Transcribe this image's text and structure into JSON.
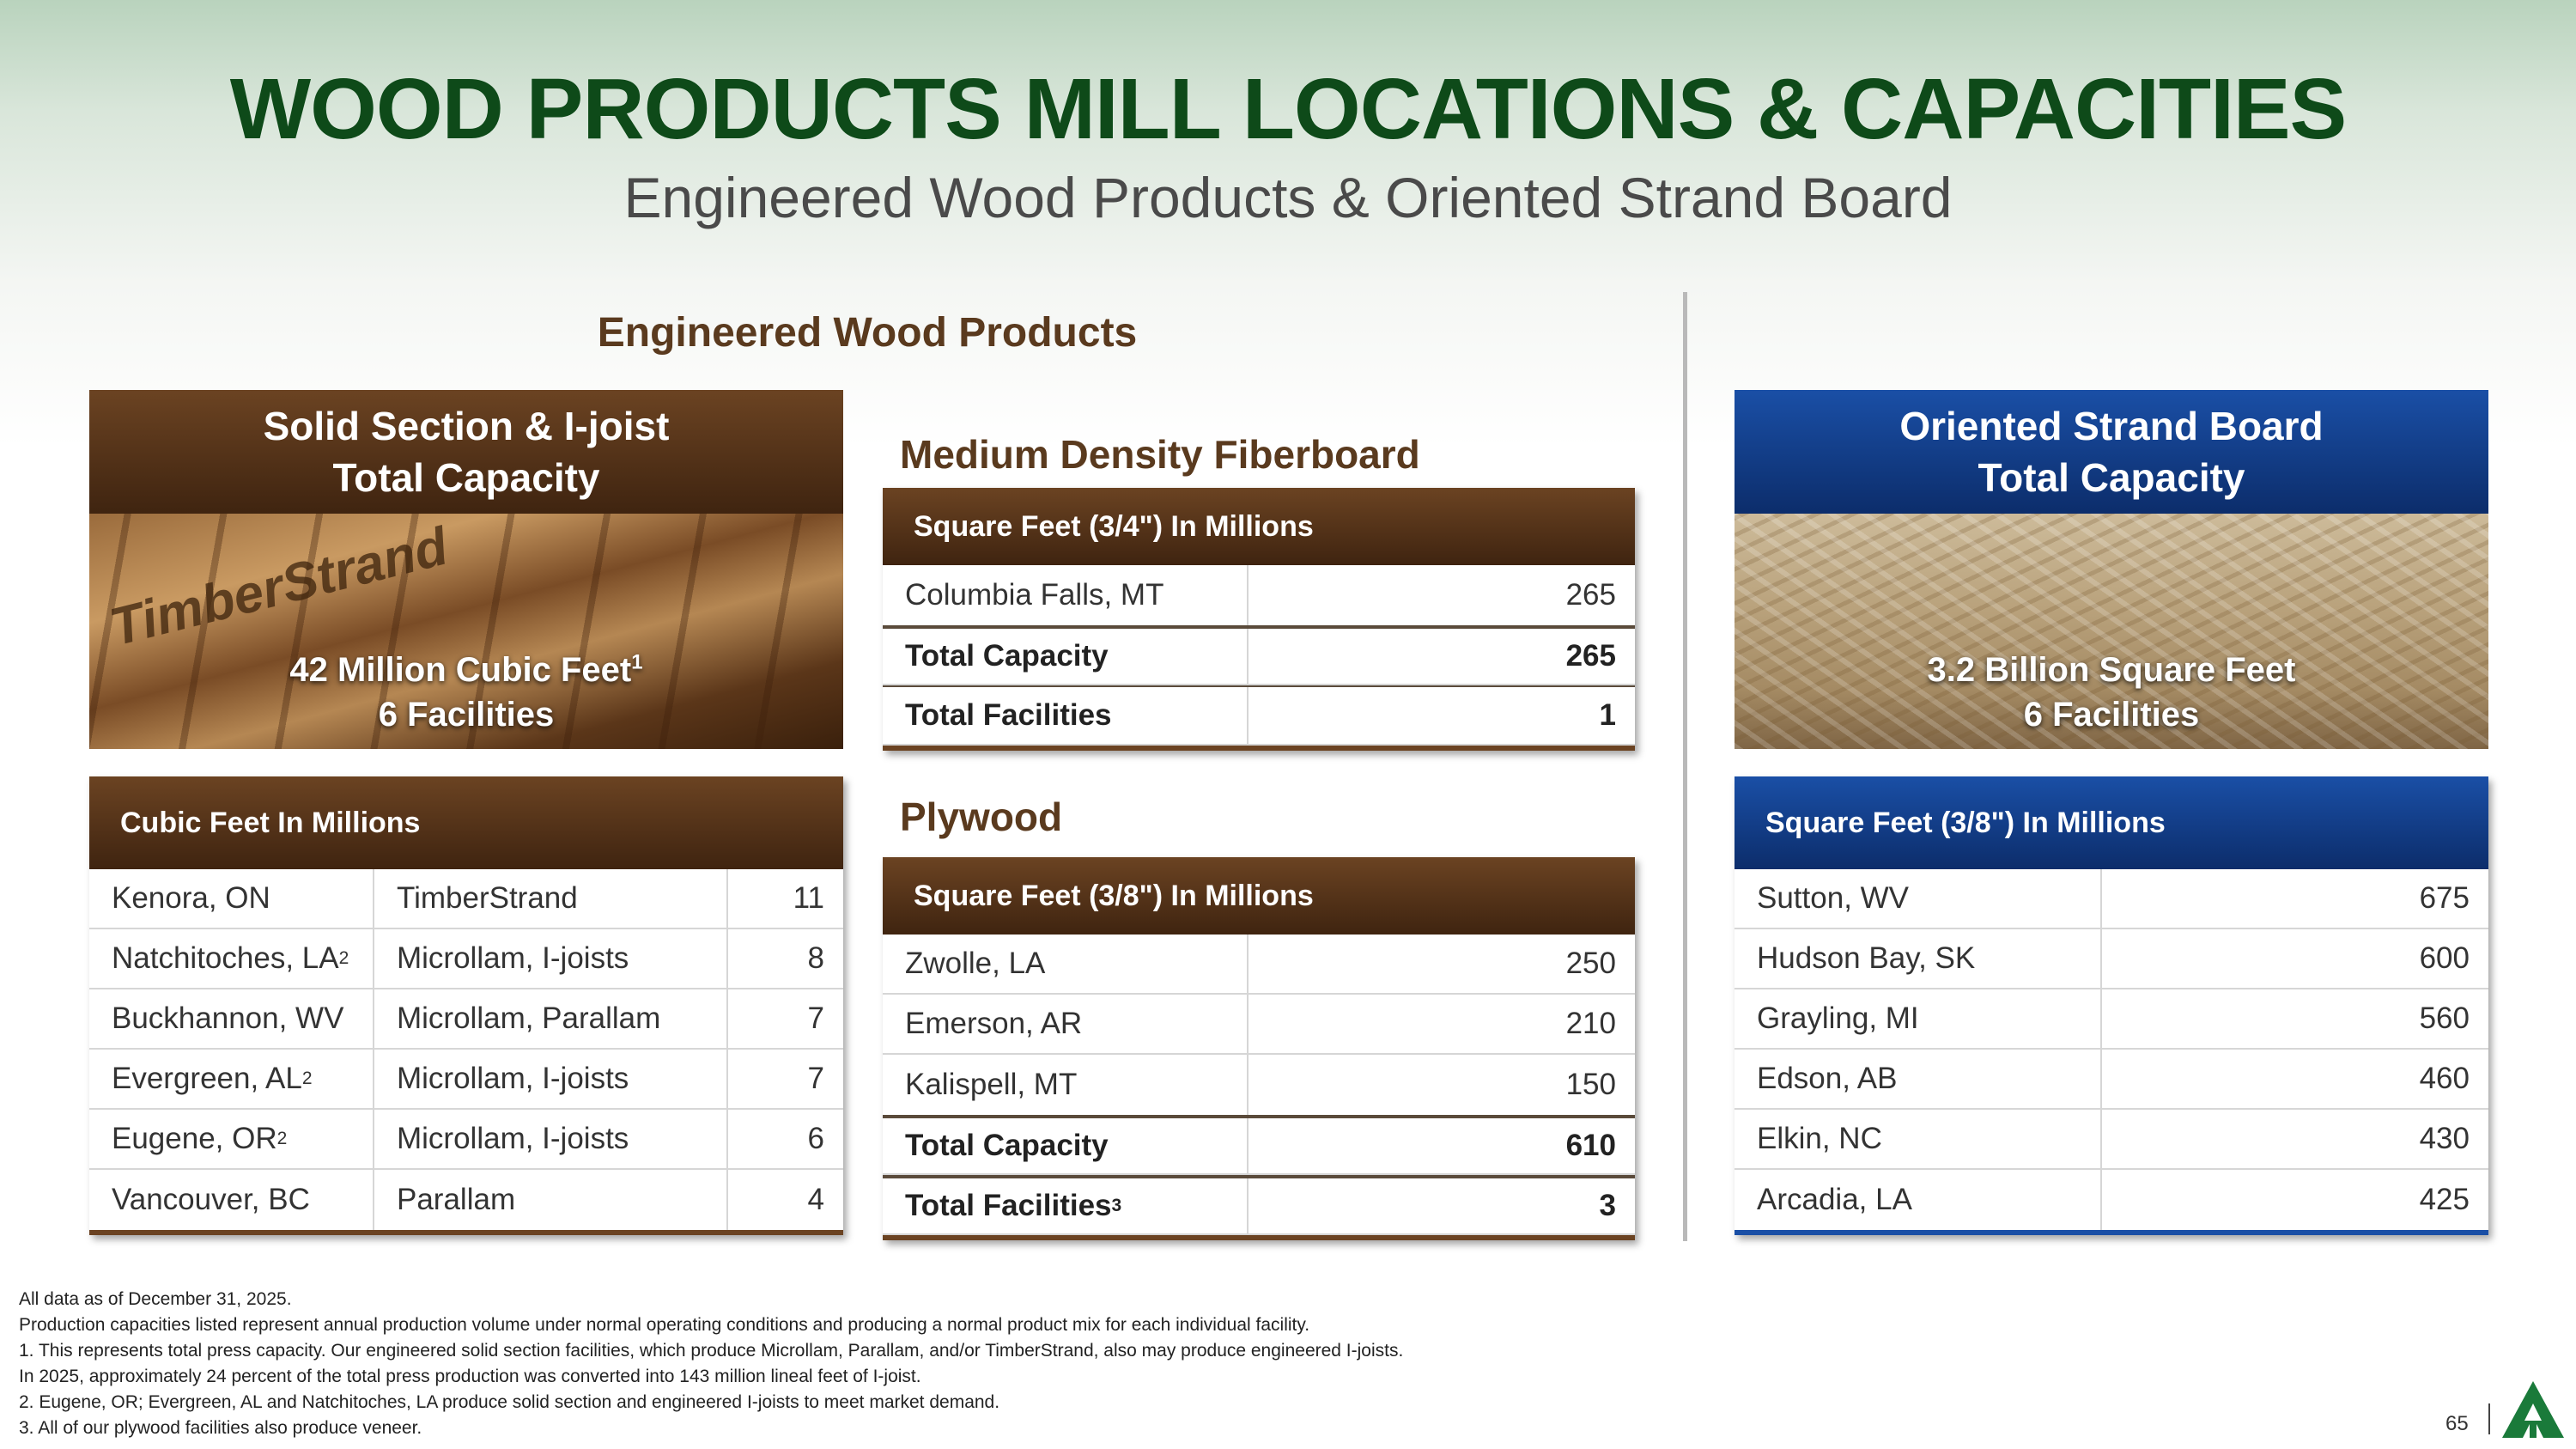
{
  "header": {
    "title": "WOOD PRODUCTS MILL LOCATIONS & CAPACITIES",
    "subtitle": "Engineered Wood Products & Oriented Strand Board"
  },
  "ewp": {
    "section_title": "Engineered Wood Products",
    "hero": {
      "title_line1": "Solid Section & I-joist",
      "title_line2": "Total Capacity",
      "stat_line1": "42 Million Cubic Feet",
      "stat_line1_sup": "1",
      "stat_line2": "6 Facilities",
      "photo_text": "TimberStrand"
    },
    "table": {
      "header": "Cubic Feet In Millions",
      "rows": [
        {
          "location": "Kenora, ON",
          "sup": "",
          "product": "TimberStrand",
          "value": "11"
        },
        {
          "location": "Natchitoches, LA",
          "sup": "2",
          "product": "Microllam, I-joists",
          "value": "8"
        },
        {
          "location": "Buckhannon, WV",
          "sup": "",
          "product": "Microllam, Parallam",
          "value": "7"
        },
        {
          "location": "Evergreen, AL",
          "sup": "2",
          "product": "Microllam, I-joists",
          "value": "7"
        },
        {
          "location": "Eugene, OR ",
          "sup": "2",
          "product": "Microllam, I-joists",
          "value": "6"
        },
        {
          "location": "Vancouver, BC",
          "sup": "",
          "product": "Parallam",
          "value": "4"
        }
      ]
    }
  },
  "mdf": {
    "title": "Medium Density Fiberboard",
    "header": "Square Feet (3/4\") In Millions",
    "rows": [
      {
        "location": "Columbia Falls, MT",
        "value": "265"
      }
    ],
    "total_capacity_label": "Total Capacity",
    "total_capacity": "265",
    "total_facilities_label": "Total Facilities",
    "total_facilities": "1"
  },
  "plywood": {
    "title": "Plywood",
    "header": "Square Feet (3/8\") In Millions",
    "rows": [
      {
        "location": "Zwolle, LA",
        "value": "250"
      },
      {
        "location": "Emerson, AR",
        "value": "210"
      },
      {
        "location": "Kalispell, MT",
        "value": "150"
      }
    ],
    "total_capacity_label": "Total Capacity",
    "total_capacity": "610",
    "total_facilities_label": "Total Facilities",
    "total_facilities_sup": "3",
    "total_facilities": "3"
  },
  "osb": {
    "hero": {
      "title_line1": "Oriented Strand Board",
      "title_line2": "Total Capacity",
      "stat_line1": "3.2 Billion Square Feet",
      "stat_line2": "6 Facilities"
    },
    "table": {
      "header": "Square Feet (3/8\") In Millions",
      "rows": [
        {
          "location": "Sutton, WV",
          "value": "675"
        },
        {
          "location": "Hudson Bay, SK",
          "value": "600"
        },
        {
          "location": "Grayling, MI",
          "value": "560"
        },
        {
          "location": "Edson, AB",
          "value": "460"
        },
        {
          "location": "Elkin, NC",
          "value": "430"
        },
        {
          "location": "Arcadia, LA",
          "value": "425"
        }
      ]
    }
  },
  "footnotes": [
    "All data as of December 31, 2025.",
    "Production capacities listed represent annual production volume under normal operating conditions and producing a normal product mix for each individual facility.",
    "1. This represents total press capacity. Our engineered solid section facilities, which produce Microllam, Parallam, and/or TimberStrand, also may produce engineered I-joists.",
    "In 2025, approximately 24 percent of the total press production was converted into 143 million lineal feet of I-joist.",
    "2. Eugene, OR; Evergreen, AL and Natchitoches, LA produce solid section and engineered I-joists to meet market demand.",
    "3. All of our plywood facilities also produce veneer."
  ],
  "page_number": "65",
  "colors": {
    "title_green": "#0e4a19",
    "brown": "#5a3a1e",
    "blue": "#0c2d6b",
    "logo_green": "#1a7a3a"
  }
}
